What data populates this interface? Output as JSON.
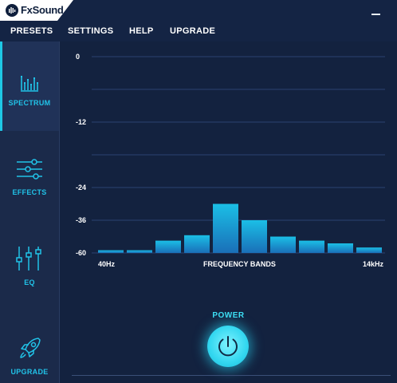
{
  "app": {
    "logo_text": "FxSound"
  },
  "menu": {
    "presets": "PRESETS",
    "settings": "SETTINGS",
    "help": "HELP",
    "upgrade": "UPGRADE"
  },
  "sidebar": {
    "items": [
      {
        "label": "SPECTRUM",
        "icon": "spectrum-icon",
        "active": true
      },
      {
        "label": "EFFECTS",
        "icon": "sliders-icon",
        "active": false
      },
      {
        "label": "EQ",
        "icon": "eq-icon",
        "active": false
      },
      {
        "label": "UPGRADE",
        "icon": "rocket-icon",
        "active": false
      }
    ]
  },
  "chart_data": {
    "type": "bar",
    "title": "",
    "xlabel": "FREQUENCY BANDS",
    "x_tick_labels": [
      "40Hz",
      "14kHz"
    ],
    "y_tick_labels": [
      "0",
      "-12",
      "-24",
      "-36",
      "-60"
    ],
    "values": [
      -58,
      -58,
      -51,
      -47,
      -30,
      -36,
      -48,
      -51,
      -53,
      -56
    ],
    "y_scale_note_ticks": [
      0,
      -12,
      -24,
      -36,
      -60
    ],
    "grid": true,
    "colors": {
      "bar_top": "#1bbfe6",
      "bar_bottom": "#1a6fb8",
      "grid": "#2b4272"
    }
  },
  "power": {
    "label": "POWER",
    "on": true
  },
  "colors": {
    "accent": "#21c3e8",
    "background": "#13223f",
    "sidebar": "#1b2a4a"
  }
}
